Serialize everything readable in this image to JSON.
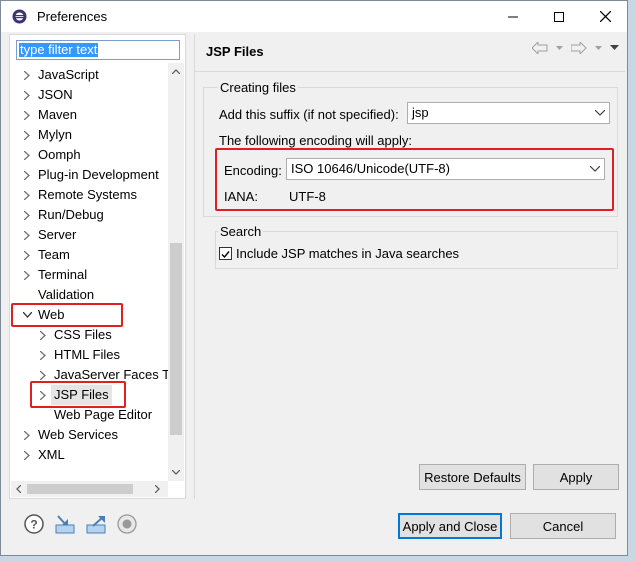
{
  "window": {
    "title": "Preferences"
  },
  "filter": {
    "placeholder": "type filter text"
  },
  "tree": {
    "items": [
      {
        "label": "JavaScript",
        "indent": 0,
        "arrow": "right"
      },
      {
        "label": "JSON",
        "indent": 0,
        "arrow": "right"
      },
      {
        "label": "Maven",
        "indent": 0,
        "arrow": "right"
      },
      {
        "label": "Mylyn",
        "indent": 0,
        "arrow": "right"
      },
      {
        "label": "Oomph",
        "indent": 0,
        "arrow": "right"
      },
      {
        "label": "Plug-in Development",
        "indent": 0,
        "arrow": "right"
      },
      {
        "label": "Remote Systems",
        "indent": 0,
        "arrow": "right"
      },
      {
        "label": "Run/Debug",
        "indent": 0,
        "arrow": "right"
      },
      {
        "label": "Server",
        "indent": 0,
        "arrow": "right"
      },
      {
        "label": "Team",
        "indent": 0,
        "arrow": "right"
      },
      {
        "label": "Terminal",
        "indent": 0,
        "arrow": "right"
      },
      {
        "label": "Validation",
        "indent": 0,
        "arrow": "none"
      },
      {
        "label": "Web",
        "indent": 0,
        "arrow": "down"
      },
      {
        "label": "CSS Files",
        "indent": 1,
        "arrow": "right"
      },
      {
        "label": "HTML Files",
        "indent": 1,
        "arrow": "right"
      },
      {
        "label": "JavaServer Faces To",
        "indent": 1,
        "arrow": "right"
      },
      {
        "label": "JSP Files",
        "indent": 1,
        "arrow": "right",
        "selected": true
      },
      {
        "label": "Web Page Editor",
        "indent": 1,
        "arrow": "none"
      },
      {
        "label": "Web Services",
        "indent": 0,
        "arrow": "right"
      },
      {
        "label": "XML",
        "indent": 0,
        "arrow": "right"
      }
    ]
  },
  "page": {
    "title": "JSP Files"
  },
  "creating_files": {
    "group_label": "Creating files",
    "suffix_label": "Add this suffix (if not specified):",
    "suffix_value": "jsp",
    "encoding_note": "The following encoding will apply:",
    "encoding_label": "Encoding:",
    "encoding_value": "ISO 10646/Unicode(UTF-8)",
    "iana_label": "IANA:",
    "iana_value": "UTF-8"
  },
  "search": {
    "group_label": "Search",
    "include_label": "Include JSP matches in Java searches",
    "include_checked": true
  },
  "buttons": {
    "restore_defaults": "Restore Defaults",
    "apply": "Apply",
    "apply_and_close": "Apply and Close",
    "cancel": "Cancel"
  },
  "colors": {
    "highlight": "#e02020",
    "selection": "#3399ff"
  }
}
